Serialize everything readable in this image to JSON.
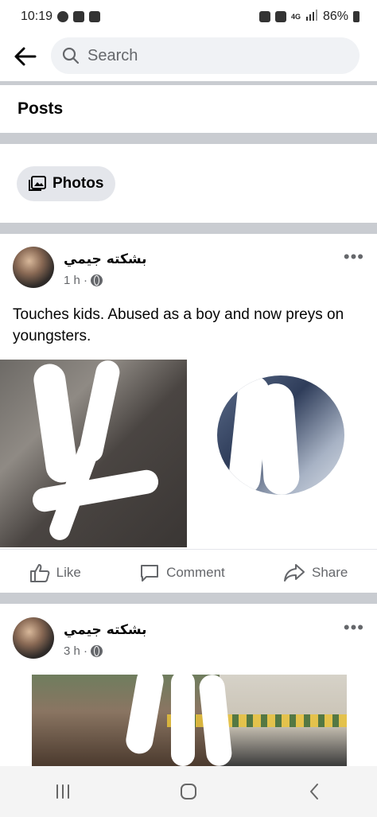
{
  "status_bar": {
    "time": "10:19",
    "battery": "86%",
    "network_label": "4G"
  },
  "search": {
    "placeholder": "Search"
  },
  "section": {
    "title": "Posts"
  },
  "filter_chip": {
    "label": "Photos"
  },
  "posts": [
    {
      "author": "بشكته جيمي",
      "time": "1 h ·",
      "text": "Touches kids. Abused as a boy and now preys on youngsters."
    },
    {
      "author": "بشكته جيمي",
      "time": "3 h ·"
    }
  ],
  "actions": {
    "like": "Like",
    "comment": "Comment",
    "share": "Share"
  },
  "colors": {
    "divider": "#c9ccd1",
    "chip_bg": "#e4e6eb",
    "search_bg": "#f0f2f5",
    "meta_text": "#65676b"
  }
}
